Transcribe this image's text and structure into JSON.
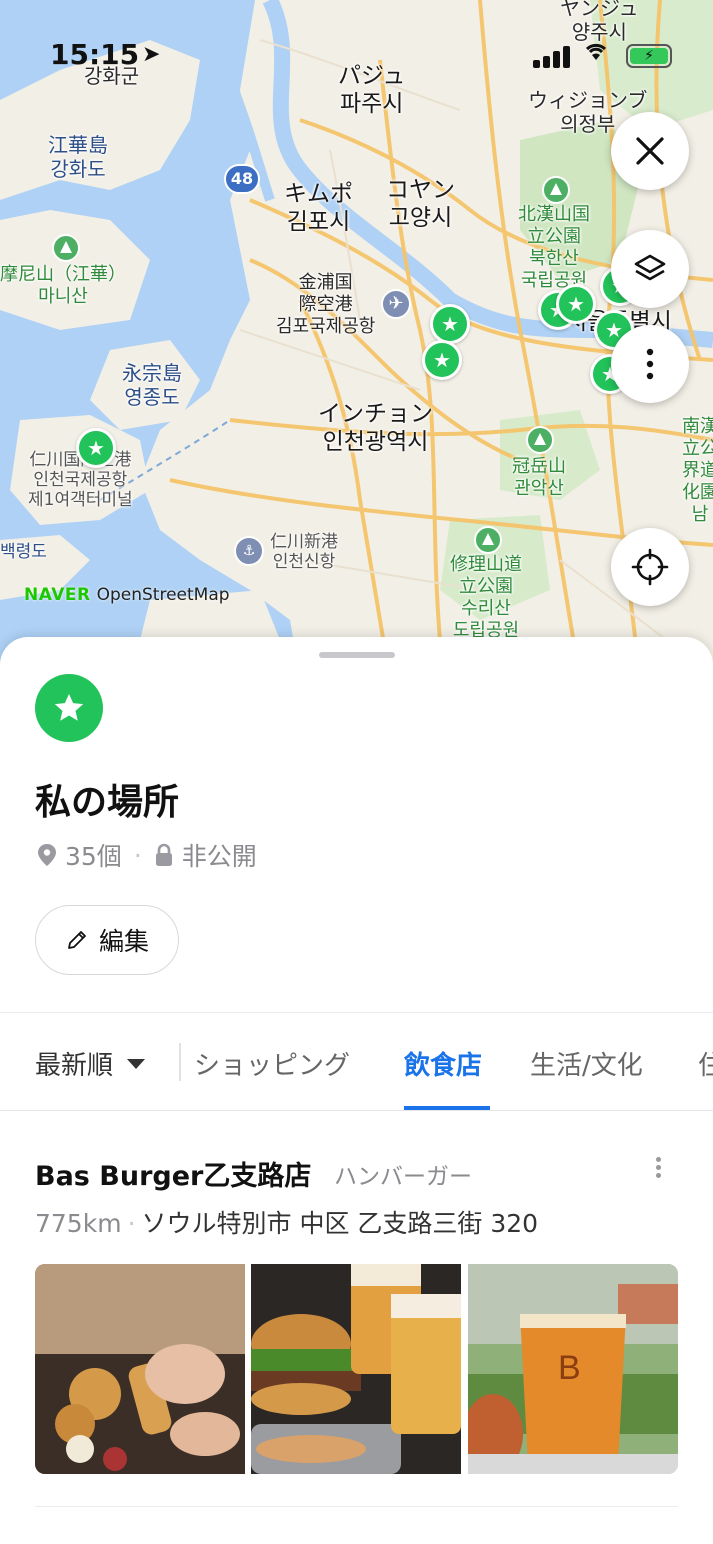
{
  "status_bar": {
    "time": "15:15",
    "location_arrow": "location-arrow-icon",
    "battery_charging": true
  },
  "map": {
    "attribution": {
      "naver": "NAVER",
      "osm": "OpenStreetMap"
    },
    "route_badge": "48",
    "labels": {
      "ganghwa_gun": "강화군",
      "paju": "パジュ\n파주시",
      "yangju": "ヤンジュ\n양주시",
      "uijeongbu": "ウィジョンブ\n의정부",
      "ganghwado": "江華島\n강화도",
      "mani": "摩尼山（江華）\n마니산",
      "gimpo": "キムポ\n김포시",
      "goyang": "コヤン\n고양시",
      "bukhansan": "北漢山国\n立公園\n북한산\n국립공원",
      "gimpo_airport": "金浦国\n際空港\n김포국제공항",
      "seoul": "서울특별시",
      "yeongjong": "永宗島\n영종도",
      "incheon": "インチョン\n인천광역시",
      "incheon_airport": "仁川国際空港\n인천국제공항\n제1여객터미널",
      "gwanak": "冠岳山\n관악산",
      "baengnyeong": "백령도",
      "incheon_port": "仁川新港\n인천신항",
      "surisan": "修理山道\n立公園\n수리산\n도립공원",
      "namyangju": "南漢\n立公\n界道\n化園\n남"
    }
  },
  "map_controls": {
    "close": "close-icon",
    "layers": "layers-icon",
    "more": "more-vertical-icon",
    "locate": "crosshair-icon"
  },
  "sheet": {
    "list_title": "私の場所",
    "count": "35個",
    "visibility": "非公開",
    "edit_label": "編集",
    "sort_label": "最新順",
    "tabs": [
      "ショッピング",
      "飲食店",
      "生活/文化",
      "住"
    ],
    "active_tab": "飲食店"
  },
  "place": {
    "name": "Bas Burger乙支路店",
    "category": "ハンバーガー",
    "distance": "775km",
    "address": "ソウル特別市 中区 乙支路三街 320"
  },
  "colors": {
    "accent": "#1a73e8",
    "pin_green": "#22c35a",
    "naver_green": "#1ec800"
  }
}
